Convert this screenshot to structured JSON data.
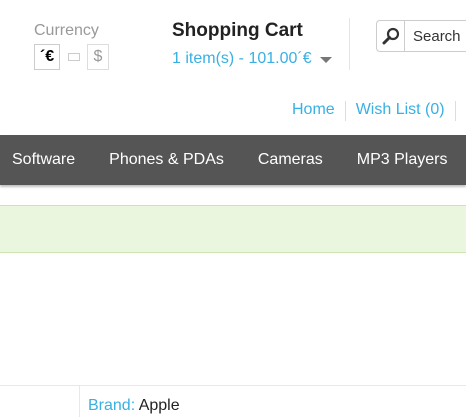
{
  "currency": {
    "label": "Currency",
    "euro_symbol": "´€",
    "dollar_symbol": "$"
  },
  "cart": {
    "title": "Shopping Cart",
    "summary": "1 item(s) - 101.00´€"
  },
  "search": {
    "placeholder": "Search"
  },
  "top_links": {
    "home": "Home",
    "wishlist": "Wish List (0)"
  },
  "menu": {
    "items": [
      "Software",
      "Phones & PDAs",
      "Cameras",
      "MP3 Players"
    ]
  },
  "product": {
    "brand_label": "Brand:",
    "brand_value": "Apple"
  },
  "colors": {
    "link": "#38b0e3",
    "menu_bg": "#555555",
    "alert_bg": "#eaf6dd"
  }
}
